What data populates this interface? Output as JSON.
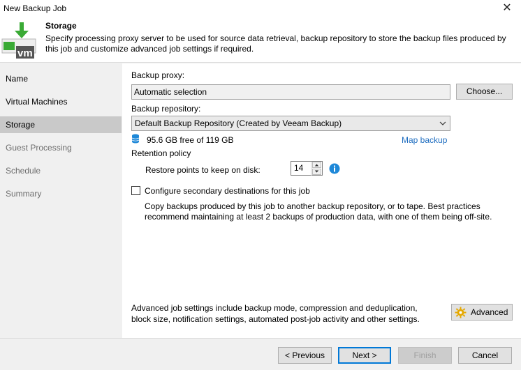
{
  "window": {
    "title": "New Backup Job"
  },
  "header": {
    "title": "Storage",
    "description": "Specify processing proxy server to be used for source data retrieval, backup repository to store the backup files produced by this job and customize advanced job settings if required.",
    "logo_text": "vm"
  },
  "sidebar": {
    "items": [
      {
        "label": "Name"
      },
      {
        "label": "Virtual Machines"
      },
      {
        "label": "Storage"
      },
      {
        "label": "Guest Processing"
      },
      {
        "label": "Schedule"
      },
      {
        "label": "Summary"
      }
    ]
  },
  "storage": {
    "proxy_label": "Backup proxy:",
    "proxy_value": "Automatic selection",
    "choose_button": "Choose...",
    "repository_label": "Backup repository:",
    "repository_value": "Default Backup Repository (Created by Veeam Backup)",
    "free_space": "95.6 GB free of 119 GB",
    "map_backup_link": "Map backup",
    "retention_title": "Retention policy",
    "restore_points_label": "Restore points to keep on disk:",
    "restore_points_value": "14",
    "secondary_label": "Configure secondary destinations for this job",
    "secondary_desc_line1": "Copy backups produced by this job to another backup repository, or to tape. Best practices",
    "secondary_desc_line2": "recommend maintaining at least 2 backups of production data, with one of them being off-site.",
    "advanced_desc_line1": "Advanced job settings include backup mode, compression and deduplication,",
    "advanced_desc_line2": "block size, notification settings, automated post-job activity and other settings.",
    "advanced_button": "Advanced"
  },
  "footer": {
    "previous": "< Previous",
    "next": "Next >",
    "finish": "Finish",
    "cancel": "Cancel"
  },
  "colors": {
    "active_nav": "#c9c9c9",
    "link": "#1f6ec0",
    "logo_green": "#3aaa35",
    "info_blue": "#1e88d8"
  },
  "icons": {
    "close": "close-icon",
    "logo": "veeam-vm-logo",
    "database": "database-icon",
    "info": "info-icon",
    "advanced": "gear-icon",
    "dropdown": "chevron-down-icon"
  }
}
